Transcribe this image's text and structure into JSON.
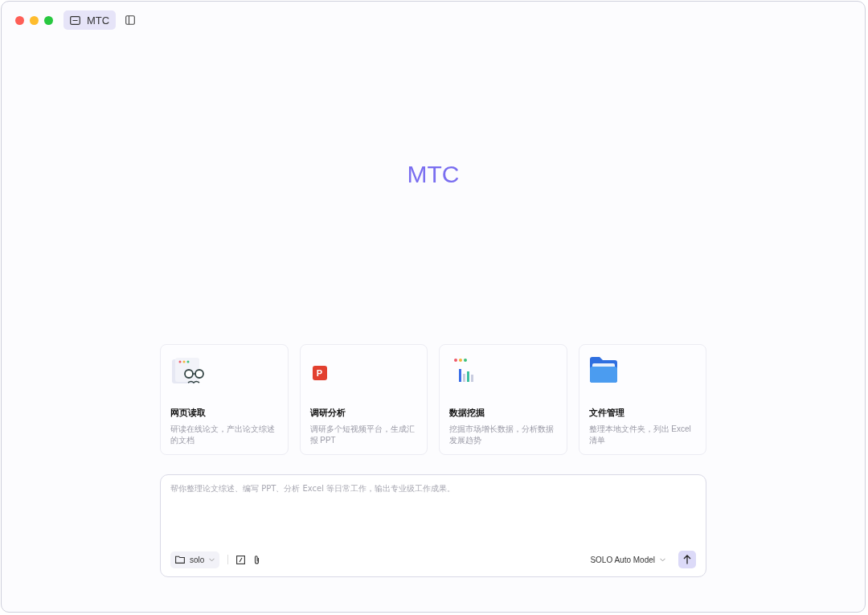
{
  "titlebar": {
    "tabs": [
      {
        "label": "MTC",
        "selected": true
      }
    ]
  },
  "logo": "MTC",
  "cards": [
    {
      "kind": "reader",
      "title": "网页读取",
      "description": "研读在线论文，产出论文综述的文档"
    },
    {
      "kind": "ppt",
      "title": "调研分析",
      "description": "调研多个短视频平台，生成汇报 PPT",
      "icon_text": "P"
    },
    {
      "kind": "chart",
      "title": "数据挖掘",
      "description": "挖掘市场增长数据，分析数据发展趋势"
    },
    {
      "kind": "folder",
      "title": "文件管理",
      "description": "整理本地文件夹，列出 Excel 清单"
    }
  ],
  "composer": {
    "placeholder": "帮你整理论文综述、编写 PPT、分析 Excel 等日常工作，输出专业级工作成果。",
    "workspace": "solo",
    "model": "SOLO Auto Model"
  }
}
